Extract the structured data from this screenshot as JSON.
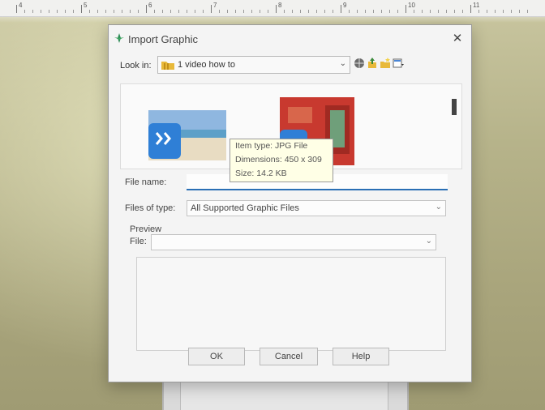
{
  "ruler": {
    "numbers": [
      "4",
      "5",
      "6",
      "7",
      "8",
      "9",
      "10",
      "11"
    ]
  },
  "dialog": {
    "title": "Import Graphic",
    "close_glyph": "✕",
    "look_in_label": "Look in:",
    "look_in_value": "1 video how to",
    "toolbar_icons": [
      "globe-icon",
      "up-folder-icon",
      "new-folder-icon",
      "view-menu-icon"
    ],
    "thumbnails": [
      "beach-image-thumbnail",
      "red-room-image-thumbnail"
    ],
    "tooltip": {
      "item_type": "Item type: JPG File",
      "dimensions": "Dimensions: 450 x 309",
      "size": "Size: 14.2 KB"
    },
    "file_name_label": "File name:",
    "file_name_value": "",
    "files_of_type_label": "Files of type:",
    "files_of_type_value": "All Supported Graphic Files",
    "preview_label": "Preview",
    "file_label": "File:",
    "file_value": "",
    "buttons": {
      "ok": "OK",
      "cancel": "Cancel",
      "help": "Help"
    }
  },
  "colors": {
    "accent": "#2a6fb5",
    "folder": "#e8b93a",
    "icon_blue": "#2f7fd6",
    "tooltip_bg": "#ffffe6"
  }
}
